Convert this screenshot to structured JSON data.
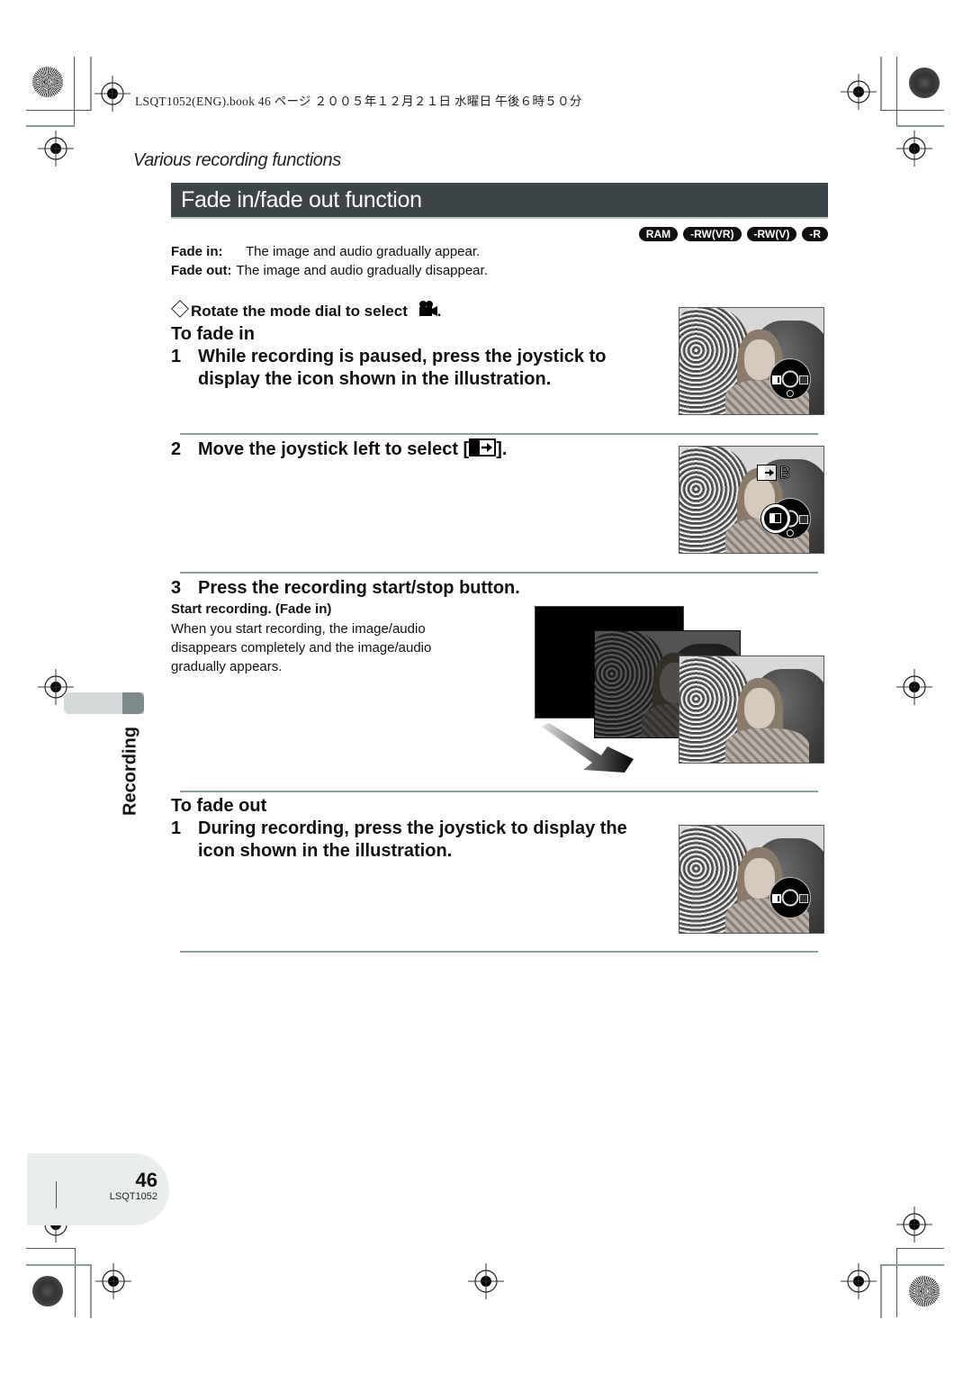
{
  "print_header": {
    "text": "LSQT1052(ENG).book  46 ページ  ２００５年１２月２１日  水曜日  午後６時５０分"
  },
  "section": {
    "category": "Various recording functions",
    "title": "Fade in/fade out function"
  },
  "disc_badges": [
    "RAM",
    "-RW(VR)",
    "-RW(V)",
    "-R"
  ],
  "definitions": [
    {
      "term": "Fade in:",
      "text": "The image and audio gradually appear."
    },
    {
      "term": "Fade out:",
      "text": "The image and audio gradually disappear."
    }
  ],
  "mode_instruction": {
    "prefix_icon": "diamond-icon",
    "text": "Rotate the mode dial to select",
    "suffix_icon": "video-camera-icon",
    "end": "."
  },
  "fade_in": {
    "heading": "To fade in",
    "steps": [
      {
        "num": "1",
        "text": "While recording is paused, press the joystick to display the icon shown in the illustration."
      },
      {
        "num": "2",
        "text_before": "Move the joystick left to select [",
        "icon": "fade-select-icon",
        "text_after": "]."
      },
      {
        "num": "3",
        "text": "Press the recording start/stop button."
      }
    ],
    "note_title": "Start recording. (Fade in)",
    "note_text": "When you start recording, the image/audio disappears completely and the image/audio gradually appears.",
    "overlay_indicator": "B"
  },
  "fade_out": {
    "heading": "To fade out",
    "steps": [
      {
        "num": "1",
        "text": "During recording, press the joystick to display the icon shown in the illustration."
      }
    ]
  },
  "side_tab": {
    "label": "Recording"
  },
  "footer": {
    "page_number": "46",
    "doc_code": "LSQT1052"
  },
  "colors": {
    "title_bar": "#3d4548",
    "separator": "#8d9c9d",
    "side_tab": "#d3d9d9",
    "side_tab_accent": "#7c8a8c",
    "page_tab": "#e9ecec"
  }
}
